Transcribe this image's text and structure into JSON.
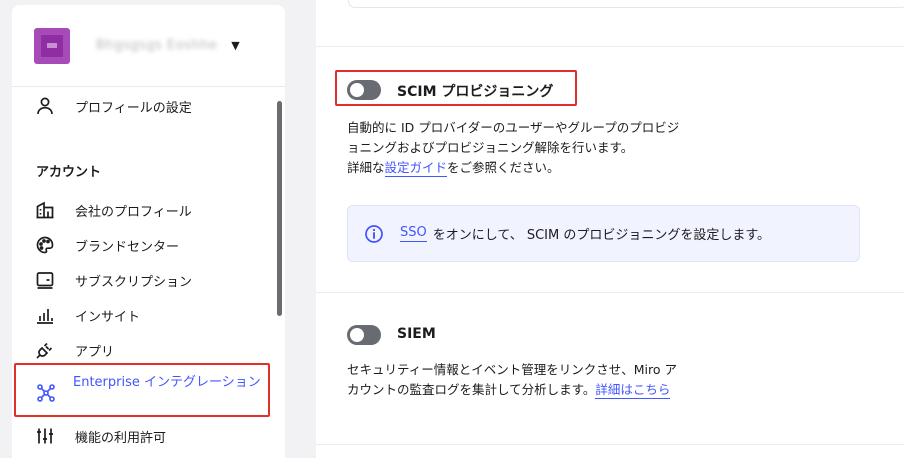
{
  "sidebar": {
    "workspace_name": "Bhgsgsgs Eoshhe",
    "profile_settings": "プロフィールの設定",
    "section_account": "アカウント",
    "items": {
      "company_profile": "会社のプロフィール",
      "brand_center": "ブランドセンター",
      "subscription": "サブスクリプション",
      "insights": "インサイト",
      "apps": "アプリ",
      "enterprise_integrations": "Enterprise インテグレーション",
      "feature_permissions": "機能の利用許可"
    }
  },
  "scim": {
    "title": "SCIM プロビジョニング",
    "toggle_state": "off",
    "desc_line1": "自動的に ID プロバイダーのユーザーやグループのプロビジ",
    "desc_line2": "ョニングおよびプロビジョニング解除を行います。",
    "desc_line3_prefix": "詳細な",
    "desc_link": "設定ガイド",
    "desc_line3_suffix": "をご参照ください。",
    "info_link": "SSO",
    "info_text": "をオンにして、 SCIM のプロビジョニングを設定します。"
  },
  "siem": {
    "title": "SIEM",
    "toggle_state": "off",
    "desc_line1": "セキュリティー情報とイベント管理をリンクさせ、Miro ア",
    "desc_line2_prefix": "カウントの監査ログを集計して分析します。",
    "desc_link": "詳細はこちら"
  },
  "colors": {
    "accent": "#4255ff",
    "highlight": "#e0302b",
    "toggle_off": "#696b73",
    "info_bg": "#f1f3ff"
  }
}
